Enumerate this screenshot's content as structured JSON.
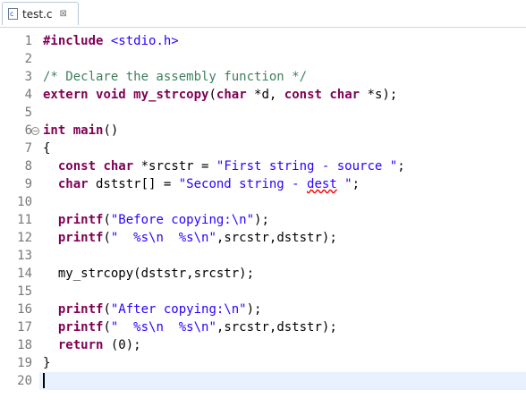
{
  "tab": {
    "file_icon_letter": "c",
    "label": "test.c",
    "close_glyph": "⊠"
  },
  "editor": {
    "line_numbers": [
      "1",
      "2",
      "3",
      "4",
      "5",
      "6",
      "7",
      "8",
      "9",
      "10",
      "11",
      "12",
      "13",
      "14",
      "15",
      "16",
      "17",
      "18",
      "19",
      "20"
    ],
    "current_line": 20,
    "lines": [
      [
        [
          "kw",
          "#include"
        ],
        [
          "txt",
          " "
        ],
        [
          "str",
          "<stdio.h>"
        ]
      ],
      [],
      [
        [
          "cmt",
          "/* Declare the assembly function */"
        ]
      ],
      [
        [
          "kw",
          "extern"
        ],
        [
          "txt",
          " "
        ],
        [
          "kw",
          "void"
        ],
        [
          "txt",
          " "
        ],
        [
          "kw",
          "my_strcopy"
        ],
        [
          "txt",
          "("
        ],
        [
          "kw",
          "char"
        ],
        [
          "txt",
          " *d, "
        ],
        [
          "kw",
          "const"
        ],
        [
          "txt",
          " "
        ],
        [
          "kw",
          "char"
        ],
        [
          "txt",
          " *s);"
        ]
      ],
      [],
      [
        [
          "kw",
          "int"
        ],
        [
          "txt",
          " "
        ],
        [
          "kw",
          "main"
        ],
        [
          "txt",
          "()"
        ]
      ],
      [
        [
          "txt",
          "{"
        ]
      ],
      [
        [
          "txt",
          "  "
        ],
        [
          "kw",
          "const"
        ],
        [
          "txt",
          " "
        ],
        [
          "kw",
          "char"
        ],
        [
          "txt",
          " *srcstr = "
        ],
        [
          "str",
          "\"First string - source \""
        ],
        [
          "txt",
          ";"
        ]
      ],
      [
        [
          "txt",
          "  "
        ],
        [
          "kw",
          "char"
        ],
        [
          "txt",
          " dststr[] = "
        ],
        [
          "str",
          "\"Second string - "
        ],
        [
          "str dest-err",
          "dest"
        ],
        [
          "str",
          " \""
        ],
        [
          "txt",
          ";"
        ]
      ],
      [],
      [
        [
          "txt",
          "  "
        ],
        [
          "kw",
          "printf"
        ],
        [
          "txt",
          "("
        ],
        [
          "str",
          "\"Before copying:\\n\""
        ],
        [
          "txt",
          ");"
        ]
      ],
      [
        [
          "txt",
          "  "
        ],
        [
          "kw",
          "printf"
        ],
        [
          "txt",
          "("
        ],
        [
          "str",
          "\"  %s\\n  %s\\n\""
        ],
        [
          "txt",
          ",srcstr,dststr);"
        ]
      ],
      [],
      [
        [
          "txt",
          "  my_strcopy(dststr,srcstr);"
        ]
      ],
      [],
      [
        [
          "txt",
          "  "
        ],
        [
          "kw",
          "printf"
        ],
        [
          "txt",
          "("
        ],
        [
          "str",
          "\"After copying:\\n\""
        ],
        [
          "txt",
          ");"
        ]
      ],
      [
        [
          "txt",
          "  "
        ],
        [
          "kw",
          "printf"
        ],
        [
          "txt",
          "("
        ],
        [
          "str",
          "\"  %s\\n  %s\\n\""
        ],
        [
          "txt",
          ",srcstr,dststr);"
        ]
      ],
      [
        [
          "txt",
          "  "
        ],
        [
          "kw",
          "return"
        ],
        [
          "txt",
          " (0);"
        ]
      ],
      [
        [
          "txt",
          "}"
        ]
      ],
      []
    ]
  },
  "colors": {
    "keyword": "#7f0055",
    "string": "#2a00ff",
    "comment": "#3f7f5f",
    "line_number": "#787878",
    "current_line_bg": "#e8f2fe",
    "error_underline": "#ff0000"
  }
}
